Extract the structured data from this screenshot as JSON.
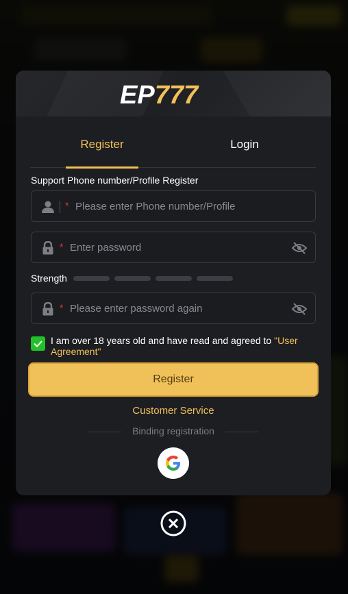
{
  "brand": {
    "logo_text": "EP777"
  },
  "tabs": [
    {
      "label": "Register",
      "active": true
    },
    {
      "label": "Login",
      "active": false
    }
  ],
  "form": {
    "section_label": "Support Phone number/Profile Register",
    "phone": {
      "required_mark": "*",
      "placeholder": "Please enter Phone number/Profile",
      "value": ""
    },
    "password": {
      "required_mark": "*",
      "placeholder": "Enter password",
      "value": ""
    },
    "strength_label": "Strength",
    "strength_level": 0,
    "confirm_password": {
      "required_mark": "*",
      "placeholder": "Please enter password again",
      "value": ""
    },
    "agreement": {
      "checked": true,
      "text": "I am over 18 years old and have read and agreed to ",
      "link": "\"User Agreement\""
    },
    "submit_label": "Register"
  },
  "customer_service": "Customer Service",
  "binding_label": "Binding registration",
  "social": [
    {
      "name": "google-icon"
    }
  ],
  "colors": {
    "accent": "#f0c059",
    "danger": "#e23b3b",
    "check": "#22c02a",
    "panel": "#1d1e22"
  }
}
